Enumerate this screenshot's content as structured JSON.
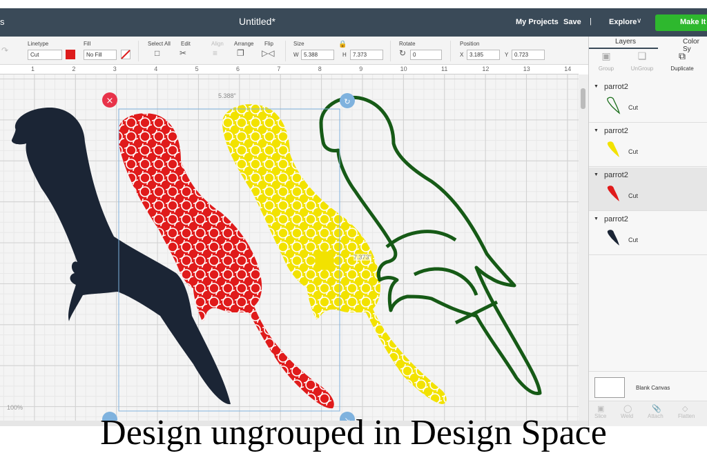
{
  "topbar": {
    "left_text": "s",
    "title": "Untitled*",
    "my_projects": "My Projects",
    "save": "Save",
    "separator": "|",
    "explore": "Explore",
    "make_it": "Make It"
  },
  "toolbar": {
    "linetype_label": "Linetype",
    "linetype_value": "Cut",
    "fill_label": "Fill",
    "fill_value": "No Fill",
    "select_all_label": "Select All",
    "edit_label": "Edit",
    "align_label": "Align",
    "arrange_label": "Arrange",
    "flip_label": "Flip",
    "size_label": "Size",
    "w_label": "W",
    "w_value": "5.388",
    "h_label": "H",
    "h_value": "7.373",
    "rotate_label": "Rotate",
    "rotate_value": "0",
    "position_label": "Position",
    "x_label": "X",
    "x_value": "3.185",
    "y_label": "Y",
    "y_value": "0.723",
    "linetype_color": "#dd1c1c"
  },
  "ruler": {
    "ticks": [
      "1",
      "2",
      "3",
      "4",
      "5",
      "6",
      "7",
      "8",
      "9",
      "10",
      "11",
      "12",
      "13",
      "14"
    ]
  },
  "canvas": {
    "width_label": "5.388\"",
    "height_label": "7.373\"",
    "zoom": "100%",
    "selection_color": "#7fb2de"
  },
  "panel": {
    "tabs": [
      "Layers",
      "Color Sy"
    ],
    "buttons": [
      "Group",
      "UnGroup",
      "Duplicate"
    ],
    "layers": [
      {
        "name": "parrot2",
        "op": "Cut",
        "color": "#1b6e1b",
        "outline": true
      },
      {
        "name": "parrot2",
        "op": "Cut",
        "color": "#f2e200",
        "outline": false
      },
      {
        "name": "parrot2",
        "op": "Cut",
        "color": "#e01b1b",
        "outline": false
      },
      {
        "name": "parrot2",
        "op": "Cut",
        "color": "#1b2535",
        "outline": false
      }
    ],
    "blank_canvas": "Blank Canvas",
    "bottom_buttons": [
      "Slice",
      "Weld",
      "Attach",
      "Flatten"
    ]
  },
  "caption": "Design ungrouped in Design Space",
  "colors": {
    "navy": "#1b2535",
    "red": "#e01b1b",
    "yellow": "#f2e200",
    "green": "#165a16"
  }
}
